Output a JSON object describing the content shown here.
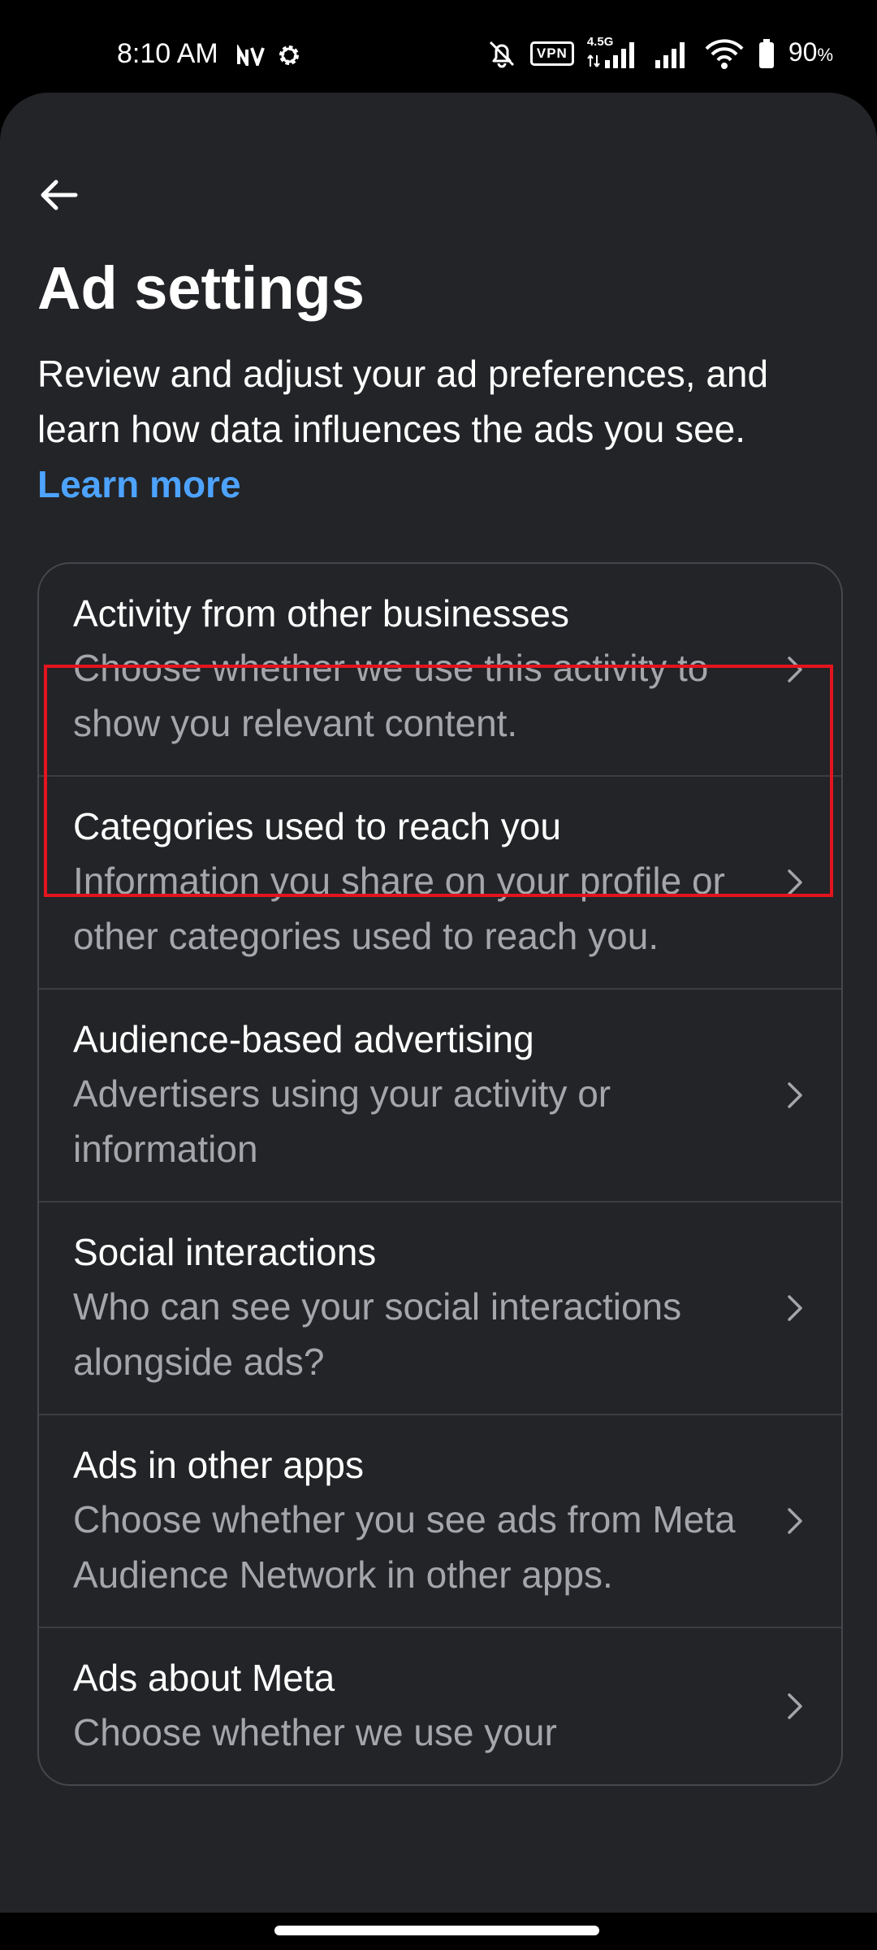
{
  "status_bar": {
    "time": "8:10 AM",
    "network_type": "4.5G",
    "vpn_label": "VPN",
    "battery_percent": "90",
    "battery_unit": "%",
    "icons": [
      "nv-icon",
      "gear-icon",
      "bell-off-icon",
      "vpn-icon",
      "signal-icon",
      "signal-icon",
      "wifi-icon",
      "battery-icon"
    ]
  },
  "header": {
    "back_icon": "arrow-left-icon",
    "title": "Ad settings",
    "description": "Review and adjust your ad preferences, and learn how data influences the ads you see.",
    "learn_more": "Learn more",
    "link_color": "#4da3ff"
  },
  "settings": {
    "items": [
      {
        "title": "Activity from other businesses",
        "description": "Choose whether we use this activity to show you relevant content."
      },
      {
        "title": "Categories used to reach you",
        "description": "Information you share on your profile or other categories used to reach you."
      },
      {
        "title": "Audience-based advertising",
        "description": "Advertisers using your activity or information"
      },
      {
        "title": "Social interactions",
        "description": "Who can see your social interactions alongside ads?"
      },
      {
        "title": "Ads in other apps",
        "description": "Choose whether you see ads from Meta Audience Network in other apps."
      },
      {
        "title": "Ads about Meta",
        "description": "Choose whether we use your"
      }
    ]
  },
  "highlight_color": "#e3141e"
}
